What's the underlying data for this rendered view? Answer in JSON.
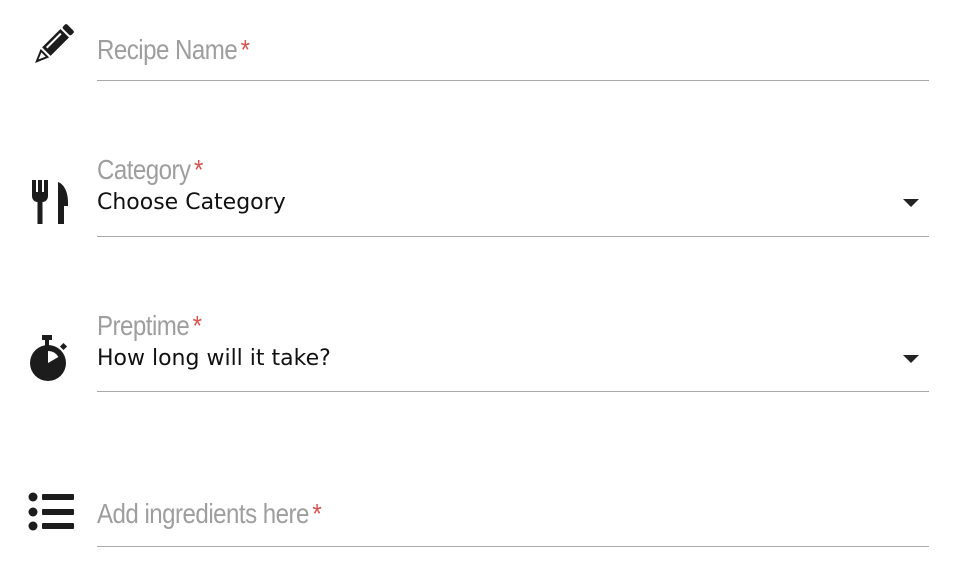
{
  "form": {
    "recipe_name": {
      "label": "Recipe Name",
      "required_mark": "*",
      "icon": "pencil-icon"
    },
    "category": {
      "label": "Category",
      "required_mark": "*",
      "value": "Choose Category",
      "icon": "fork-knife-icon"
    },
    "preptime": {
      "label": "Preptime",
      "required_mark": "*",
      "value": "How long will it take?",
      "icon": "stopwatch-icon"
    },
    "ingredients": {
      "label": "Add ingredients here",
      "required_mark": "*",
      "icon": "list-icon"
    }
  },
  "colors": {
    "label": "#9e9e9e",
    "required": "#d9534f",
    "underline": "#a9a9a9",
    "icon": "#1c1c1c"
  }
}
